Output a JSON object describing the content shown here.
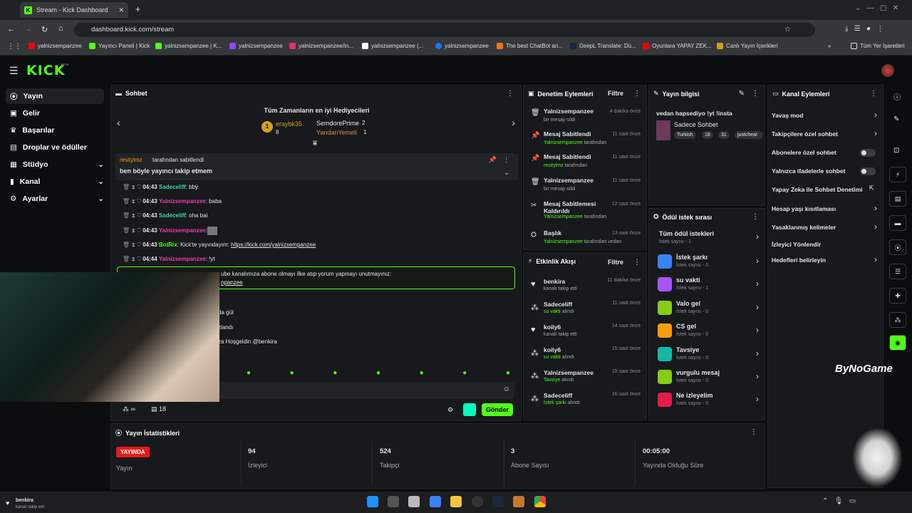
{
  "browser": {
    "tab_title": "Stream - Kick Dashboard",
    "url": "dashboard.kick.com/stream",
    "bookmarks": [
      "yalnizsempanzee",
      "Yayıncı Paneli | Kick",
      "yalnizsempanzee | K...",
      "yalnizsempanzee",
      "yalnizsempanzee/in...",
      "yalnizsempanzee (...",
      "yalnizsempanzee",
      "The best ChatBot an...",
      "DeepL Translate: Dü...",
      "Oyunlara YAPAY ZEK...",
      "Canlı Yayın İçerikleri"
    ],
    "all_bookmarks": "Tüm Yer İşaretleri"
  },
  "app": {
    "logo": "KICK",
    "beta": "BETA"
  },
  "sidebar": {
    "items": [
      {
        "label": "Yayın"
      },
      {
        "label": "Gelir"
      },
      {
        "label": "Başarılar"
      },
      {
        "label": "Droplar ve ödüller"
      },
      {
        "label": "Stüdyo"
      },
      {
        "label": "Kanal"
      },
      {
        "label": "Ayarlar"
      }
    ]
  },
  "chat": {
    "title": "Sohbet",
    "gifters_title": "Tüm Zamanların en iyi Hediyecileri",
    "gifters": [
      {
        "rank": "1",
        "name": "eraybk35",
        "count": "8"
      },
      {
        "name": "SemdorePrime",
        "count": "2"
      },
      {
        "name": "YandanYemeli",
        "count": "1"
      }
    ],
    "pinned_by": "resitylmz",
    "pinned_suffix": "tarafından sabitlendi",
    "pinned_text": "ben böyle yayıncı takip etmem",
    "messages": [
      {
        "time": "04:43",
        "user": "Sadeceliff",
        "text": ": bby"
      },
      {
        "time": "04:43",
        "user": "Yalnizsempanzee",
        "text": ": baba"
      },
      {
        "time": "04:43",
        "user": "Sadeceliff",
        "text": ": oha bai"
      },
      {
        "time": "04:43",
        "user": "Yalnizsempanzee",
        "text": ":"
      },
      {
        "time": "04:43",
        "user": "BotRix",
        "text": ": Kick'te yayındayım: ",
        "link": "https://kick.com/yalnizsempanzee"
      },
      {
        "time": "04:44",
        "user": "Yalnizsempanzee",
        "text": ": !yt"
      }
    ],
    "highlight_line1": "ube kanalımıza abone olmayı ilke atıp yorum yapmayı unutmayınız:",
    "highlight_line2": "npanzee",
    "partials": [
      "da gül",
      "zlandı",
      "za Hoşgeldin @benkira"
    ],
    "count": "18",
    "infinity": "∞",
    "send": "Gönder"
  },
  "moderation": {
    "title": "Denetim Eylemleri",
    "filter": "Filtre",
    "items": [
      {
        "title": "Yalnizsempanzee",
        "sub": "bir mesajı sildi",
        "time": "4 dakika önce"
      },
      {
        "title": "Mesaj Sabitlendi",
        "sub_user": "Yalnizsempanzee",
        "sub": "tarafından",
        "time": "11 saat önce"
      },
      {
        "title": "Mesaj Sabitlendi",
        "sub_user": "resitylmz",
        "sub": "tarafından",
        "time": "11 saat önce"
      },
      {
        "title": "Yalnizsempanzee",
        "sub": "bir mesajı sildi",
        "time": "11 saat önce"
      },
      {
        "title": "Mesaj Sabitlemesi Kaldırıldı",
        "sub_user": "Yalnizsempanzee",
        "sub": "tarafından",
        "time": "12 saat önce"
      },
      {
        "title": "Başlık",
        "sub_user": "Yalnizsempanzee",
        "sub": "tarafından vedan",
        "time": "13 saat önce"
      }
    ]
  },
  "activity": {
    "title": "Etkinlik Akışı",
    "filter": "Filtre",
    "items": [
      {
        "user": "benkira",
        "sub": "kanalı takip etti",
        "time": "11 dakika önce"
      },
      {
        "user": "Sadeceliff",
        "sub_item": "su vakti",
        "sub": "alındı",
        "time": "11 saat önce"
      },
      {
        "user": "koily6",
        "sub": "kanalı takip etti",
        "time": "14 saat önce"
      },
      {
        "user": "koily6",
        "sub_item": "su vakti",
        "sub": "alındı",
        "time": "15 saat önce"
      },
      {
        "user": "Yalnizsempanzee",
        "sub_item": "Tavsiye",
        "sub": "alındı",
        "time": "15 saat önce"
      },
      {
        "user": "Sadeceliff",
        "sub_item": "İstek şarkı",
        "sub": "alındı",
        "time": "16 saat önce"
      }
    ]
  },
  "stream_info": {
    "title": "Yayın bilgisi",
    "stream_title": "vedan hapsediyo !yt !insta",
    "category": "Sadece Sohbet",
    "tags": [
      "Turkish",
      "18",
      "31",
      "justcheal"
    ]
  },
  "rewards": {
    "title": "Ödül istek sırası",
    "all": "Tüm ödül istekleri",
    "all_count": "İstek sayısı - 1",
    "items": [
      {
        "name": "İstek şarkı",
        "count": "İstek sayısı - 0",
        "color": "#3b82f6"
      },
      {
        "name": "su vakti",
        "count": "İstek sayısı - 1",
        "color": "#a855f7"
      },
      {
        "name": "Valo gel",
        "count": "İstek sayısı - 0",
        "color": "#84cc16"
      },
      {
        "name": "CS gel",
        "count": "İstek sayısı - 0",
        "color": "#f59e0b"
      },
      {
        "name": "Tavsiye",
        "count": "İstek sayısı - 0",
        "color": "#14b8a6"
      },
      {
        "name": "vurgulu mesaj",
        "count": "İstek sayısı - 0",
        "color": "#84cc16"
      },
      {
        "name": "Ne izleyelim",
        "count": "İstek sayısı - 0",
        "color": "#e11d48"
      }
    ]
  },
  "channel": {
    "title": "Kanal Eylemleri",
    "items": [
      {
        "label": "Yavaş mod",
        "ctrl": "arrow"
      },
      {
        "label": "Takipçilere özel sohbet",
        "ctrl": "arrow"
      },
      {
        "label": "Abonelere özel sohbet",
        "ctrl": "toggle"
      },
      {
        "label": "Yalnızca ifadelerle sohbet",
        "ctrl": "toggle"
      },
      {
        "label": "Yapay Zeka ile Sohbet Denetimi",
        "ctrl": "ext"
      },
      {
        "label": "Hesap yaşı kısıtlaması",
        "ctrl": "arrow"
      },
      {
        "label": "Yasaklanmış kelimeler",
        "ctrl": "arrow"
      },
      {
        "label": "İzleyici Yönlendir",
        "ctrl": "none"
      },
      {
        "label": "Hedefleri belirleyin",
        "ctrl": "arrow"
      }
    ]
  },
  "stats": {
    "title": "Yayın İstatistikleri",
    "badge": "YAYINDA",
    "cells": [
      {
        "value": "",
        "label": "Yayın"
      },
      {
        "value": "94",
        "label": "İzleyici"
      },
      {
        "value": "524",
        "label": "Takipçi"
      },
      {
        "value": "3",
        "label": "Abone Sayısı"
      },
      {
        "value": "00:05:00",
        "label": "Yayında Olduğu Süre"
      }
    ]
  },
  "overlay": {
    "watermark": "ByNoGame",
    "follower_name": "benkira",
    "follower_sub": "kanalı takip etti"
  }
}
